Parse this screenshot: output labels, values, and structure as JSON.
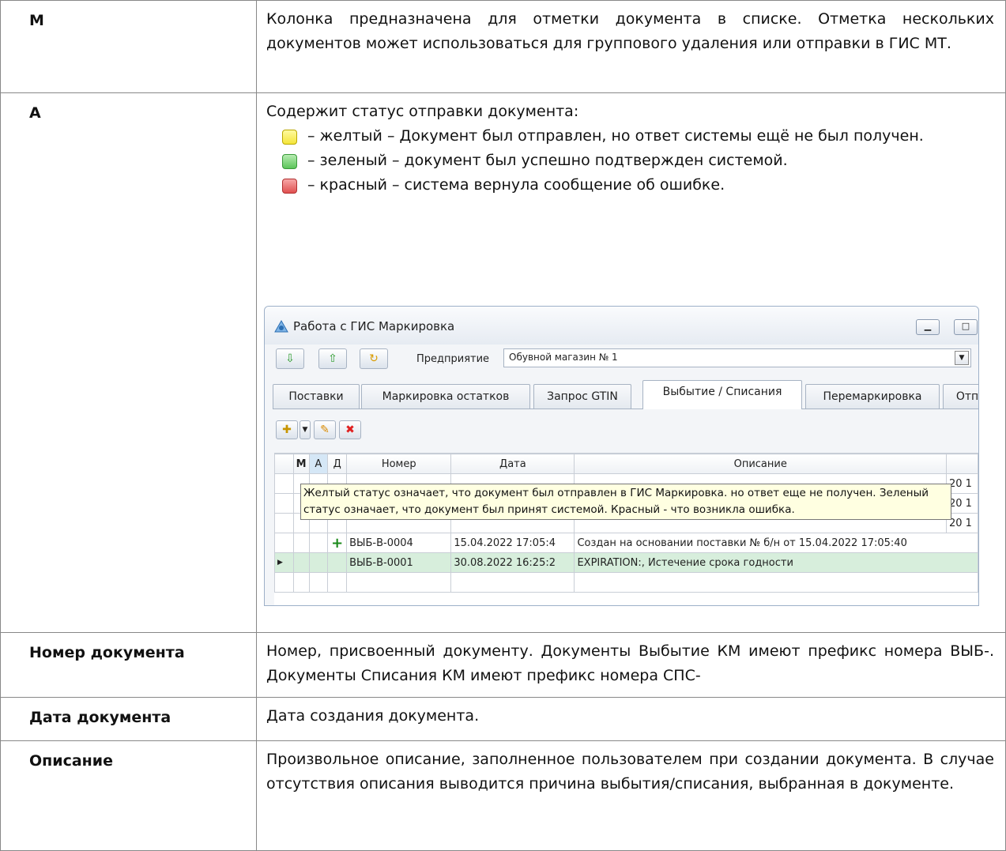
{
  "rows": {
    "m": {
      "term": "М",
      "text": "Колонка предназначена для отметки документа в списке. Отметка нескольких документов может использоваться для группового удаления или отправки в ГИС МТ."
    },
    "a": {
      "term": "А",
      "intro": "Содержит статус отправки документа:",
      "statuses": [
        {
          "color": "#f4e53a",
          "text": "– желтый – Документ был отправлен, но ответ системы ещё не был получен."
        },
        {
          "color": "#5cc55a",
          "text": "– зеленый – документ был успешно подтвержден системой."
        },
        {
          "color": "#e05050",
          "text": "– красный – система вернула сообщение об ошибке."
        }
      ]
    },
    "number": {
      "term": "Номер документа",
      "text": "Номер, присвоенный документу. Документы Выбытие КМ имеют префикс номера ВЫБ-. Документы Списания КМ имеют префикс номера СПС-"
    },
    "date": {
      "term": "Дата документа",
      "text": "Дата создания документа."
    },
    "description": {
      "term": "Описание",
      "text": "Произвольное описание, заполненное пользователем при создании документа. В случае отсутствия описания выводится причина выбытия/списания, выбранная в документе."
    }
  },
  "window": {
    "title": "Работа с ГИС Маркировка",
    "enterprise_label": "Предприятие",
    "enterprise_value": "Обувной магазин № 1",
    "tabs": [
      "Поставки",
      "Маркировка остатков",
      "Запрос GTIN",
      "Выбытие / Списания",
      "Перемаркировка",
      "Отп"
    ],
    "active_tab": "Выбытие / Списания",
    "columns": [
      "М",
      "А",
      "Д",
      "Номер",
      "Дата",
      "Описание"
    ],
    "rows": [
      {
        "number": "",
        "date": "",
        "desc": "",
        "tail": "20 1"
      },
      {
        "number": "",
        "date": "",
        "desc": "",
        "tail": "20 1"
      },
      {
        "number": "",
        "date": "",
        "desc": "",
        "tail": "20 1"
      },
      {
        "flag": "+",
        "number": "ВЫБ-В-0004",
        "date": "15.04.2022 17:05:4",
        "desc": "Создан на основании поставки № б/н от 15.04.2022 17:05:40"
      },
      {
        "number": "ВЫБ-В-0001",
        "date": "30.08.2022 16:25:2",
        "desc": "EXPIRATION:, Истечение срока годности"
      }
    ],
    "tooltip": "Желтый статус означает, что документ  был отправлен в ГИС Маркировка. но ответ еще не получен. Зеленый статус означает, что документ был принят системой. Красный - что возникла ошибка."
  }
}
